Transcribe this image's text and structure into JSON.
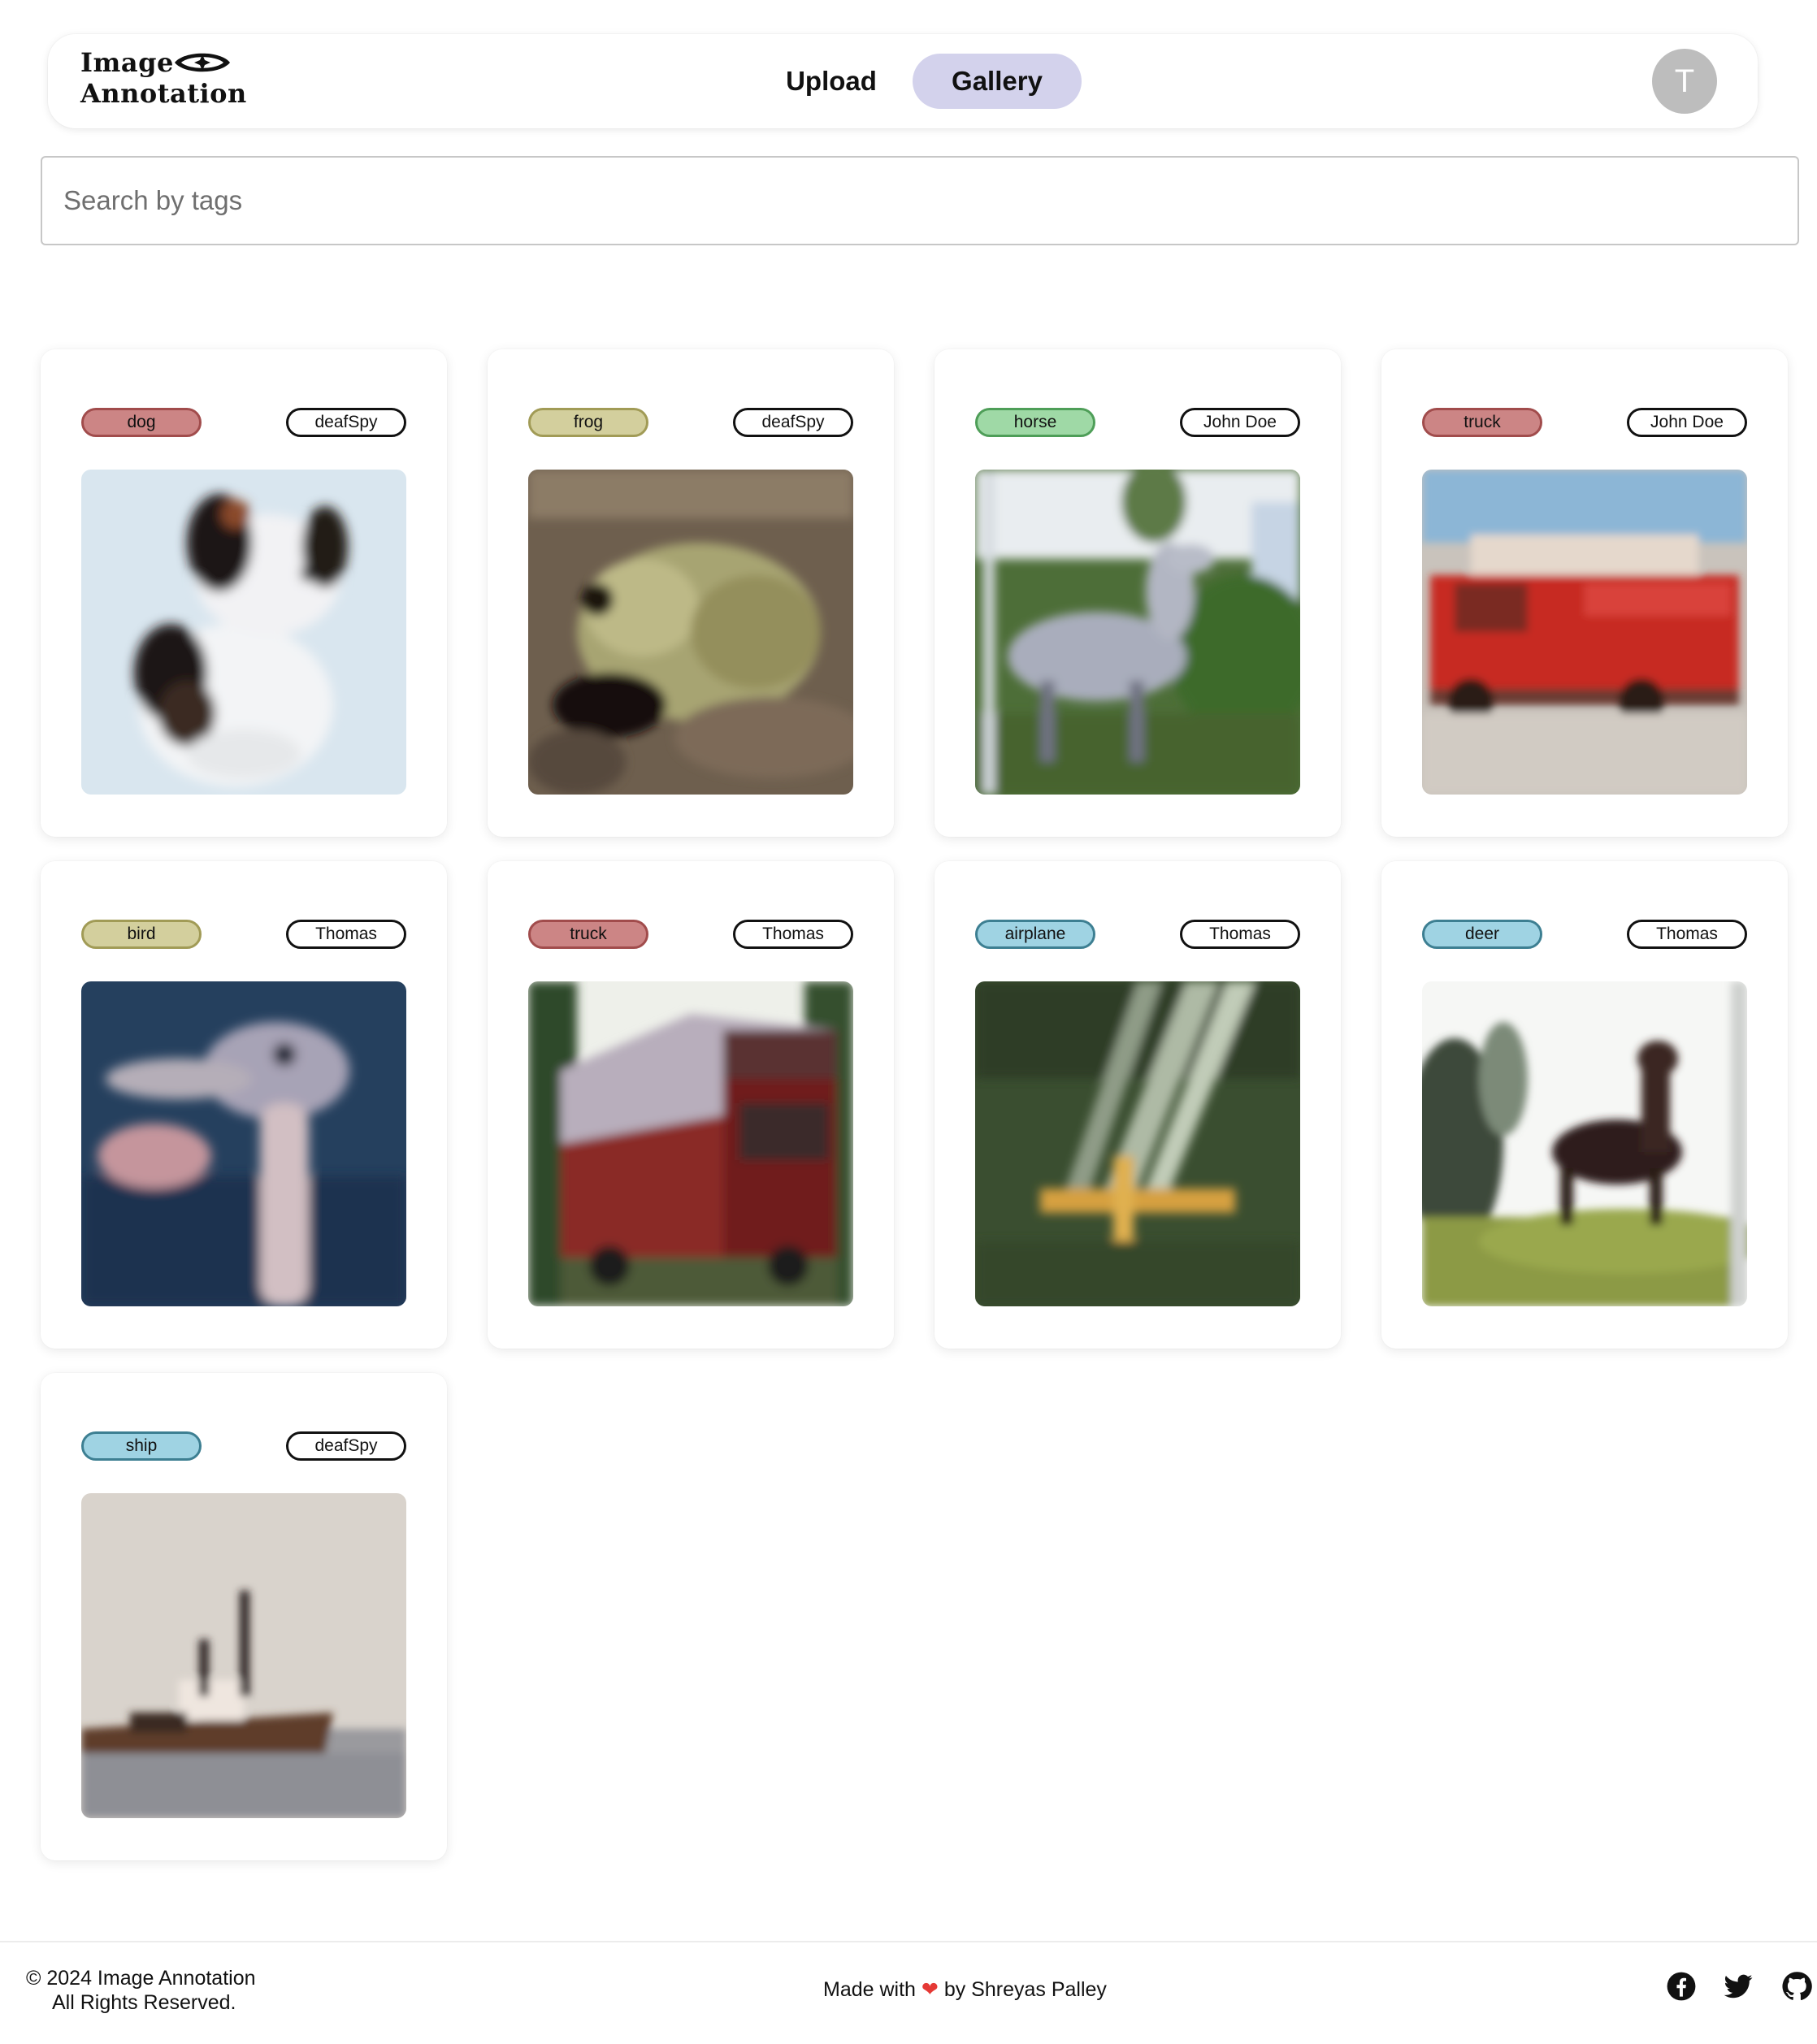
{
  "app": {
    "logo_line1": "Image",
    "logo_line2": "Annotation"
  },
  "nav": {
    "upload_label": "Upload",
    "gallery_label": "Gallery",
    "active": "Gallery",
    "avatar_initial": "T"
  },
  "search": {
    "placeholder": "Search by tags",
    "value": ""
  },
  "gallery": {
    "items": [
      {
        "tag": "dog",
        "tag_color": "#cc8585",
        "tag_border": "#a14c4c",
        "user": "deafSpy",
        "image": "dog"
      },
      {
        "tag": "frog",
        "tag_color": "#d3cf9d",
        "tag_border": "#a19b56",
        "user": "deafSpy",
        "image": "frog"
      },
      {
        "tag": "horse",
        "tag_color": "#9fd9a6",
        "tag_border": "#4e9e58",
        "user": "John Doe",
        "image": "horse"
      },
      {
        "tag": "truck",
        "tag_color": "#cc8585",
        "tag_border": "#a14c4c",
        "user": "John Doe",
        "image": "fire-truck"
      },
      {
        "tag": "bird",
        "tag_color": "#d3cf9d",
        "tag_border": "#a19b56",
        "user": "Thomas",
        "image": "ostrich"
      },
      {
        "tag": "truck",
        "tag_color": "#cc8585",
        "tag_border": "#a14c4c",
        "user": "Thomas",
        "image": "red-truck"
      },
      {
        "tag": "airplane",
        "tag_color": "#9fd3e3",
        "tag_border": "#3d7f92",
        "user": "Thomas",
        "image": "airplane"
      },
      {
        "tag": "deer",
        "tag_color": "#9fd3e3",
        "tag_border": "#3d7f92",
        "user": "Thomas",
        "image": "deer"
      },
      {
        "tag": "ship",
        "tag_color": "#9fd3e3",
        "tag_border": "#3d7f92",
        "user": "deafSpy",
        "image": "ship"
      }
    ]
  },
  "footer": {
    "copyright": "© 2024 Image Annotation",
    "rights": "All Rights Reserved.",
    "made_with_prefix": "Made with",
    "heart": "❤",
    "made_with_suffix": "by Shreyas Palley",
    "social": [
      "facebook-icon",
      "twitter-icon",
      "github-icon"
    ]
  }
}
